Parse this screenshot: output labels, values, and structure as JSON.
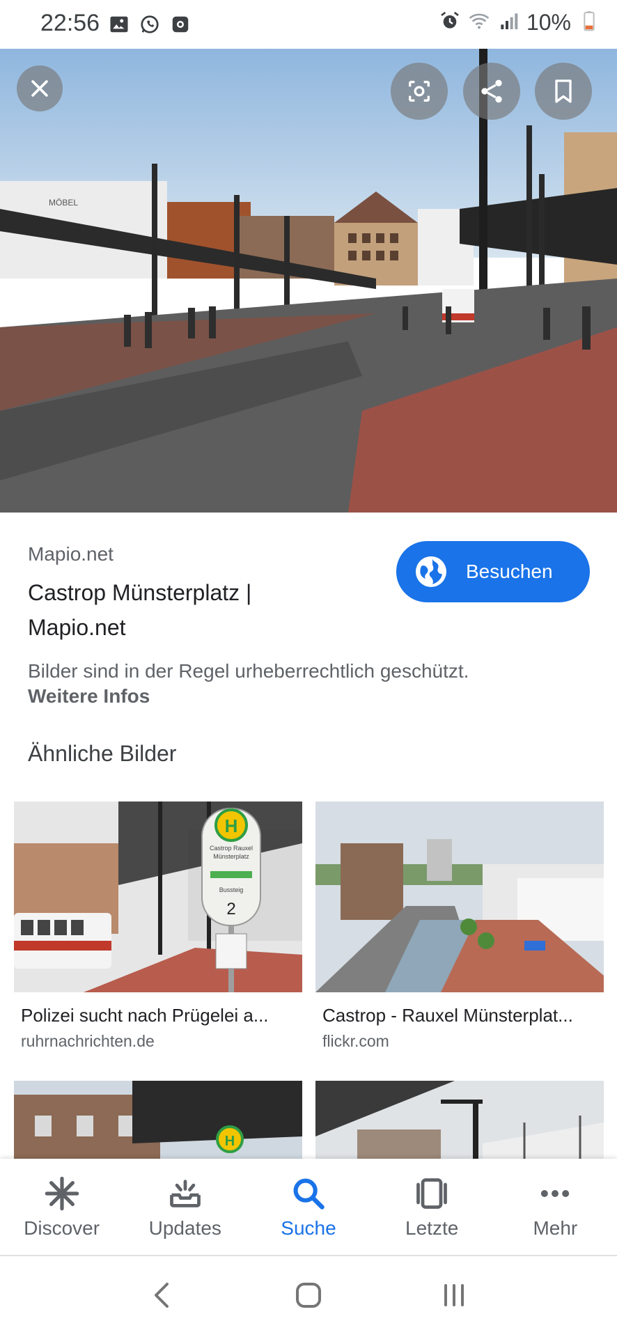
{
  "status_bar": {
    "time": "22:56",
    "battery": "10%",
    "left_icons": [
      "gallery-icon",
      "whatsapp-icon",
      "screen-record-icon"
    ],
    "right_icons": [
      "alarm-icon",
      "wifi-icon",
      "signal-icon",
      "battery-icon"
    ]
  },
  "viewer": {
    "close_icon": "close-icon",
    "lens_icon": "lens-icon",
    "share_icon": "share-icon",
    "bookmark_icon": "bookmark-icon"
  },
  "result": {
    "source": "Mapio.net",
    "title": "Castrop Münsterplatz | Mapio.net",
    "visit_label": "Besuchen",
    "copyright": "Bilder sind in der Regel urheberrechtlich geschützt.",
    "more_info": "Weitere Infos",
    "accent_color": "#1a73e8"
  },
  "similar": {
    "heading": "Ähnliche Bilder",
    "items": [
      {
        "caption": "Polizei sucht nach Prügelei a...",
        "domain": "ruhrnachrichten.de",
        "sign_letter": "H",
        "sign_line1": "Castrop Rauxel",
        "sign_line2": "Münsterplatz",
        "sign_stand": "Bussteig",
        "sign_number": "2"
      },
      {
        "caption": "Castrop - Rauxel Münsterplat...",
        "domain": "flickr.com"
      },
      {
        "sign_letter": "H"
      },
      {}
    ]
  },
  "bottom_nav": [
    {
      "label": "Discover",
      "icon": "discover-icon",
      "active": false
    },
    {
      "label": "Updates",
      "icon": "updates-icon",
      "active": false
    },
    {
      "label": "Suche",
      "icon": "search-icon",
      "active": true
    },
    {
      "label": "Letzte",
      "icon": "recent-tabs-icon",
      "active": false
    },
    {
      "label": "Mehr",
      "icon": "more-icon",
      "active": false
    }
  ],
  "hero": {
    "sign_text": "MÖBEL"
  }
}
